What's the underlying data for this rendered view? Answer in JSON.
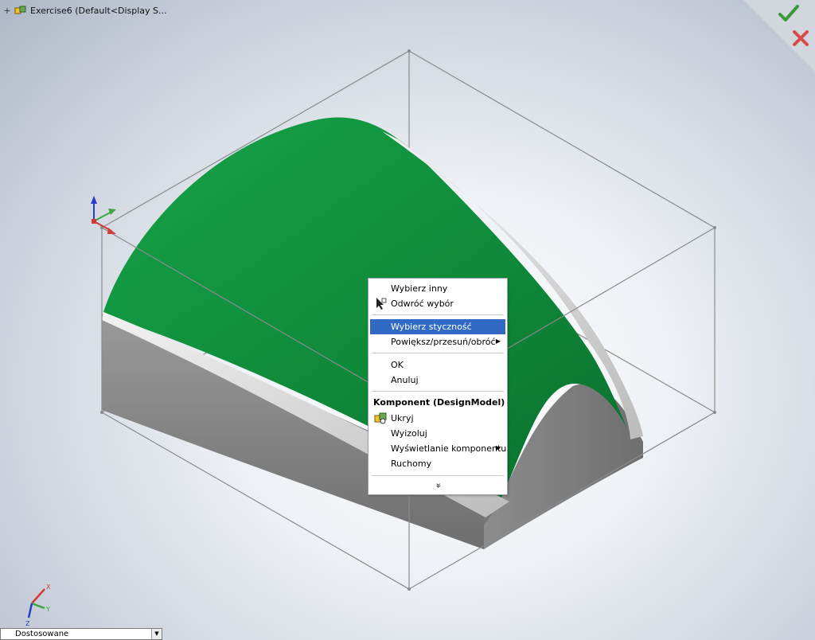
{
  "document": {
    "title": "Exercise6  (Default<Display S..."
  },
  "context_menu": {
    "items": [
      {
        "label": "Wybierz inny"
      },
      {
        "label": "Odwróć wybór"
      },
      {
        "label": "Wybierz styczność"
      },
      {
        "label": "Powiększ/przesuń/obróć"
      },
      {
        "label": "OK"
      },
      {
        "label": "Anuluj"
      },
      {
        "label": "Ukryj"
      },
      {
        "label": "Wyizoluj"
      },
      {
        "label": "Wyświetlanie komponentu"
      },
      {
        "label": "Ruchomy"
      }
    ],
    "section_header": "Komponent (DesignModel)",
    "expand_glyph": "»",
    "highlighted_item": "Wybierz styczność"
  },
  "confirm": {
    "ok_icon": "checkmark-icon",
    "cancel_icon": "cross-icon"
  },
  "configuration": {
    "selected": "Dostosowane"
  },
  "triad_axes": [
    "X",
    "Y",
    "Z"
  ],
  "colors": {
    "surface_green": "#1e9a45",
    "body_gray": "#8c8c8c",
    "highlight_blue": "#316ac5",
    "ok_green": "#3a9a3a",
    "cancel_red": "#d94a4a"
  }
}
